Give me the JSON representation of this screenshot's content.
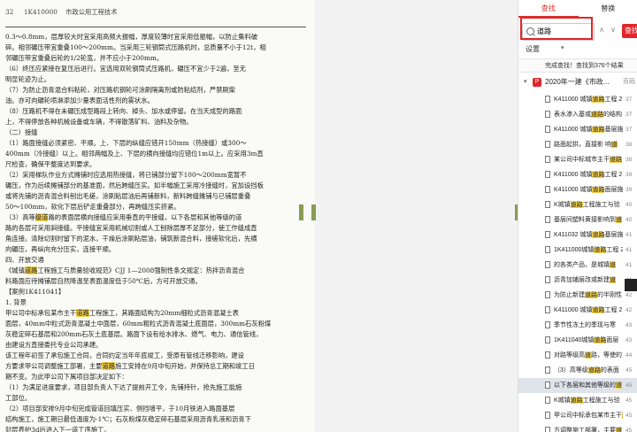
{
  "document": {
    "header": {
      "page_number": "32",
      "code": "1K410000",
      "title": "市政公用工程技术"
    },
    "lines": [
      [
        {
          "t": "0.3～0.8mm，层厚较大时宜采用高频大振幅，厚度较薄时宜采用低振幅，以防止集料破"
        }
      ],
      [
        {
          "t": "碎。相邻碾压带宜重叠100～200mm。当采用三轮钢筒式压路机时，总质量不小于12t，相"
        }
      ],
      [
        {
          "t": "邻碾压带宜重叠后轮的1/2轮宽，并不应小于200mm。"
        }
      ],
      [
        {
          "t": "（6）终压应紧接在复压后进行。宜选用双轮钢筒式压路机，碾压不宜少于2遍，至无"
        }
      ],
      [
        {
          "t": "明显轮迹为止。"
        }
      ],
      [
        {
          "t": "（7）为防止沥青混合料粘轮，对压路机钢轮可涂刷隔离剂或防粘结剂，严禁刷柴"
        }
      ],
      [
        {
          "t": "油。亦可向碾轮喷淋添加少量表面活性剂的雾状水。"
        }
      ],
      [
        {
          "t": "（8）压路机不得在未碾压成型路段上转向、掉头、加水或停留。在当天成型的路面"
        }
      ],
      [
        {
          "t": "上，不得停放各种机械设备或车辆，不得散落矿料、油料及杂物。"
        }
      ],
      [
        {
          "t": "（二）接缝"
        }
      ],
      [
        {
          "t": "（1）路面接缝必须紧密、平顺。上、下层的纵缝应错开150mm（热接缝）或300～"
        }
      ],
      [
        {
          "t": "400mm（冷接缝）以上。相邻两幅及上、下层的横向接缝均应错位1m以上。应采用3m直"
        }
      ],
      [
        {
          "t": "尺检查，确保平整度达到要求。"
        }
      ],
      [
        {
          "t": "（2）采用梯队作业方式摊铺时应选用热接缝，将已铺部分留下100～200mm宽暂不"
        }
      ],
      [
        {
          "t": "碾压，作为后续摊铺部分的基准面，然后跨缝压实。如半幅施工采用冷接缝时，宜加设挡板"
        }
      ],
      [
        {
          "t": "或将先铺的沥青混合料刨出毛槎，涂刷粘层油后再铺新料，新料跨缝摊铺与已铺层重叠"
        }
      ],
      [
        {
          "t": "50～100mm，软化下层后铲走重叠部分，再跨缝压实挤紧。"
        }
      ],
      [
        {
          "t": "（3）高等"
        },
        {
          "t": "级道",
          "h": true
        },
        {
          "t": "路的表面层横向接缝应采用垂直的平接缝，以下各层和其他等级的道"
        }
      ],
      [
        {
          "t": "路的各层可采用斜接缝。平接缝宜采用机械切割或人工刨除层厚不足部分，使工作缝成直"
        }
      ],
      [
        {
          "t": "角连接。清除切割时留下的泥水，干燥后涂刷粘层油，铺筑新混合料，接槎软化后，先横"
        }
      ],
      [
        {
          "t": "向碾压，再纵向充分压实，连接平顺。"
        }
      ],
      [
        {
          "t": "四、开放交通"
        }
      ],
      [
        {
          "t": "《城镇"
        },
        {
          "t": "道路",
          "h": true
        },
        {
          "t": "工程施工与质量验收规范》CJJ 1—2008强制性条文规定：热拌沥青混合"
        }
      ],
      [
        {
          "t": "料路面应待摊铺层自然降温至表面温度低于50℃后，方可开放交通。"
        }
      ],
      [
        {
          "t": "【案例1K411041】"
        }
      ],
      [
        {
          "t": "1. 背景"
        }
      ],
      [
        {
          "t": "甲公司中标承包某市主干"
        },
        {
          "t": "道路",
          "h": true
        },
        {
          "t": "工程施工，其路面结构为20mm细粒式沥青混凝土表"
        }
      ],
      [
        {
          "t": "面层，40mm中粒式沥青混凝土中面层，60mm粗粒式沥青混凝土底面层，300mm石灰粉煤"
        }
      ],
      [
        {
          "t": "灰稳定碎石基层和200mm石灰土底基层。路面下设有给水排水、燃气、电力、通信管线，"
        }
      ],
      [
        {
          "t": "由建设方直接委托专业公司承建。"
        }
      ],
      [
        {
          "t": "该工程年初签了承包施工合同，合同约定当年年底竣工，受原有管线迁移影响，建设"
        }
      ],
      [
        {
          "t": "方要求甲公司调整施工部署，主要"
        },
        {
          "t": "道路",
          "h": true
        },
        {
          "t": "施工安排在9月中旬开始，并保持总工期和竣工日"
        }
      ],
      [
        {
          "t": "期不变。为此甲公司下属项目部决定如下："
        }
      ],
      [
        {
          "t": "（1）为满足进度要求，项目部负责人下达了提前开工令，先铺持针，抢先施工能施"
        }
      ],
      [
        {
          "t": "工部位。"
        }
      ],
      [
        {
          "t": "（2）项目部安排9月中旬完成管道回填压实、侧挡墙平，于10月铁进入路面基层"
        }
      ],
      [
        {
          "t": "结构施工，施工期日最低温度为-1℃；石灰粉煤灰稳定碎石基层采用沥青乳液和沥青下"
        }
      ],
      [
        {
          "t": "封层养护3d后进入下一道工序施工。"
        }
      ]
    ]
  },
  "panel": {
    "tabs": [
      {
        "label": "查找",
        "active": true
      },
      {
        "label": "替换",
        "active": false
      }
    ],
    "search": {
      "value": "道路",
      "placeholder": "",
      "prev": "∧",
      "next": "∨",
      "button": "查找"
    },
    "settings": {
      "label": "设置",
      "caret": "▾"
    },
    "result_info": "完成查找！查找到376个结果",
    "file": {
      "badge": "P",
      "name": "2020年一建《市政...",
      "page": "页码"
    },
    "results": [
      {
        "pre": "K411000 城镇",
        "hit": "道路",
        "post": "工程 2",
        "page": "37",
        "sel": false
      },
      {
        "pre": "表水渗入基或",
        "hit": "道路",
        "post": "的结构",
        "page": "37",
        "sel": false
      },
      {
        "pre": "K411000 城镇",
        "hit": "道路",
        "post": "基层施",
        "page": "37",
        "sel": false
      },
      {
        "pre": "路面起拱，直接影 响",
        "hit": "道",
        "post": "",
        "page": "38",
        "sel": false
      },
      {
        "pre": "某公司中标城市主干",
        "hit": "道路",
        "post": "",
        "page": "38",
        "sel": false
      },
      {
        "pre": "K411000 城镇",
        "hit": "道路",
        "post": "工程 2",
        "page": "39",
        "sel": false
      },
      {
        "pre": "K411000 城镇",
        "hit": "道路",
        "post": "面层施",
        "page": "39",
        "sel": false
      },
      {
        "pre": "K城镇",
        "hit": "道路",
        "post": "工程施工与验",
        "page": "40",
        "sel": false
      },
      {
        "pre": "基层间塑料黄接影响到",
        "hit": "道",
        "post": "",
        "page": "40",
        "sel": false
      },
      {
        "pre": "K411032 城镇",
        "hit": "道路",
        "post": "基层施",
        "page": "41",
        "sel": false
      },
      {
        "pre": "1K411000城镇",
        "hit": "道路",
        "post": "工程 2",
        "page": "41",
        "sel": false
      },
      {
        "pre": "的各类产品，是城镇",
        "hit": "道",
        "post": "",
        "page": "41",
        "sel": false
      },
      {
        "pre": "沥青加铺层改或新建",
        "hit": "道",
        "post": "",
        "page": "41",
        "sel": false
      },
      {
        "pre": "为防止新建",
        "hit": "道路",
        "post": "的半刚性",
        "page": "42",
        "sel": false
      },
      {
        "pre": "K411000 城镇",
        "hit": "道路",
        "post": "工程 2",
        "page": "42",
        "sel": false
      },
      {
        "pre": "季节性冻土的季现与寒",
        "hit": "",
        "post": "",
        "page": "43",
        "sel": false
      },
      {
        "pre": "1K411040城镇",
        "hit": "道路",
        "post": "面层",
        "page": "43",
        "sel": false
      },
      {
        "pre": "对路等级高",
        "hit": "道",
        "post": "路，等使的",
        "page": "44",
        "sel": false
      },
      {
        "pre": "（3）高等级",
        "hit": "道路",
        "post": "的表面",
        "page": "45",
        "sel": false
      },
      {
        "pre": "以下各层和其他等级的",
        "hit": "道",
        "post": "",
        "page": "45",
        "sel": true
      },
      {
        "pre": "K城镇",
        "hit": "道路",
        "post": "工程施工与验",
        "page": "45",
        "sel": false
      },
      {
        "pre": "甲公司中标承包某市主干",
        "hit": "道",
        "post": "",
        "page": "45",
        "sel": false
      },
      {
        "pre": "方调整施工部署，主要",
        "hit": "道",
        "post": "",
        "page": "45",
        "sel": false
      },
      {
        "pre": "1K411000城镇",
        "hit": "道路",
        "post": "工程 2",
        "page": "46",
        "sel": false
      }
    ]
  }
}
